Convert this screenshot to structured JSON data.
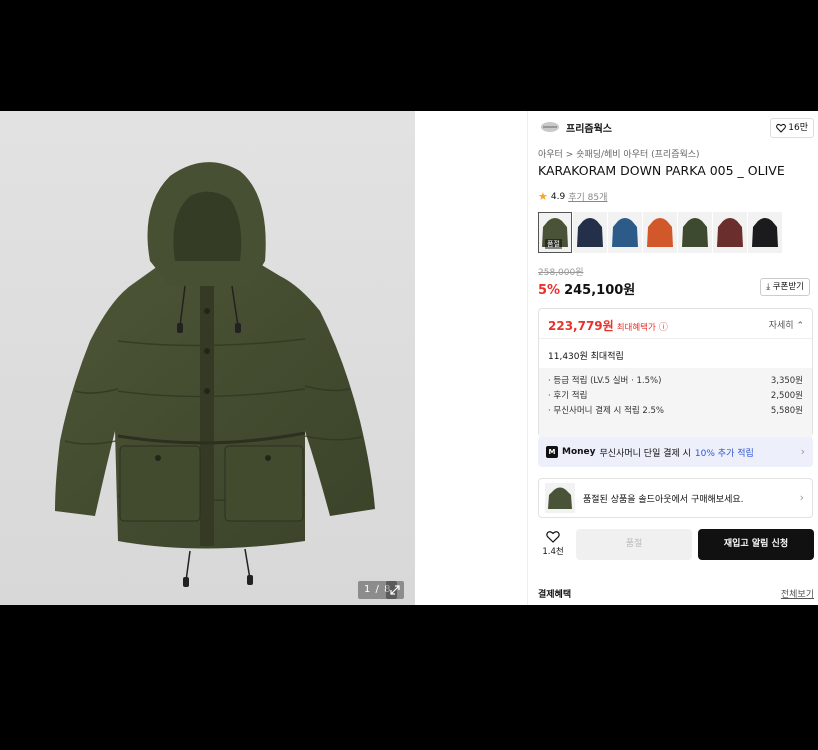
{
  "gallery": {
    "counter": "1 / 8"
  },
  "brand": {
    "name": "프리즘웍스",
    "likes": "16만"
  },
  "breadcrumb": {
    "cat1": "아우터",
    "sep": ">",
    "cat2": "숏패딩/헤비 아우터 (프리즘웍스)"
  },
  "product": {
    "title": "KARAKORAM DOWN PARKA 005 _ OLIVE"
  },
  "rating": {
    "score": "4.9",
    "reviews": "후기 85개"
  },
  "swatches": [
    {
      "color": "#4a5338",
      "sold_label": "품절"
    },
    {
      "color": "#24304a"
    },
    {
      "color": "#2c5b8a"
    },
    {
      "color": "#d0582a"
    },
    {
      "color": "#3e4a30"
    },
    {
      "color": "#6a2f2c"
    },
    {
      "color": "#1b1b1d"
    }
  ],
  "price": {
    "original": "258,000원",
    "discount": "5%",
    "sale": "245,100원",
    "coupon": "쿠폰받기"
  },
  "benefit": {
    "max_price": "223,779원",
    "max_label": "최대혜택가",
    "detail": "자세히",
    "points": "11,430원 최대적립",
    "rows": [
      {
        "label": "· 등급 적립 (LV.5 실버 · 1.5%)",
        "value": "3,350원"
      },
      {
        "label": "· 후기 적립",
        "value": "2,500원"
      },
      {
        "label": "· 무신사머니 결제 시 적립 2.5%",
        "value": "5,580원"
      }
    ]
  },
  "money": {
    "label": "Money",
    "text1": "무신사머니 단일 결제 시",
    "accent": "10% 추가 적립"
  },
  "soldout_notice": "품절된 상품을 솔드아웃에서 구매해보세요.",
  "actions": {
    "like_count": "1.4천",
    "soldout": "품절",
    "notify": "재입고 알림 신청"
  },
  "payment": {
    "title": "결제혜택",
    "view_all": "전체보기"
  },
  "colors": {
    "accent_red": "#e8322b",
    "accent_blue": "#2f55d4"
  }
}
